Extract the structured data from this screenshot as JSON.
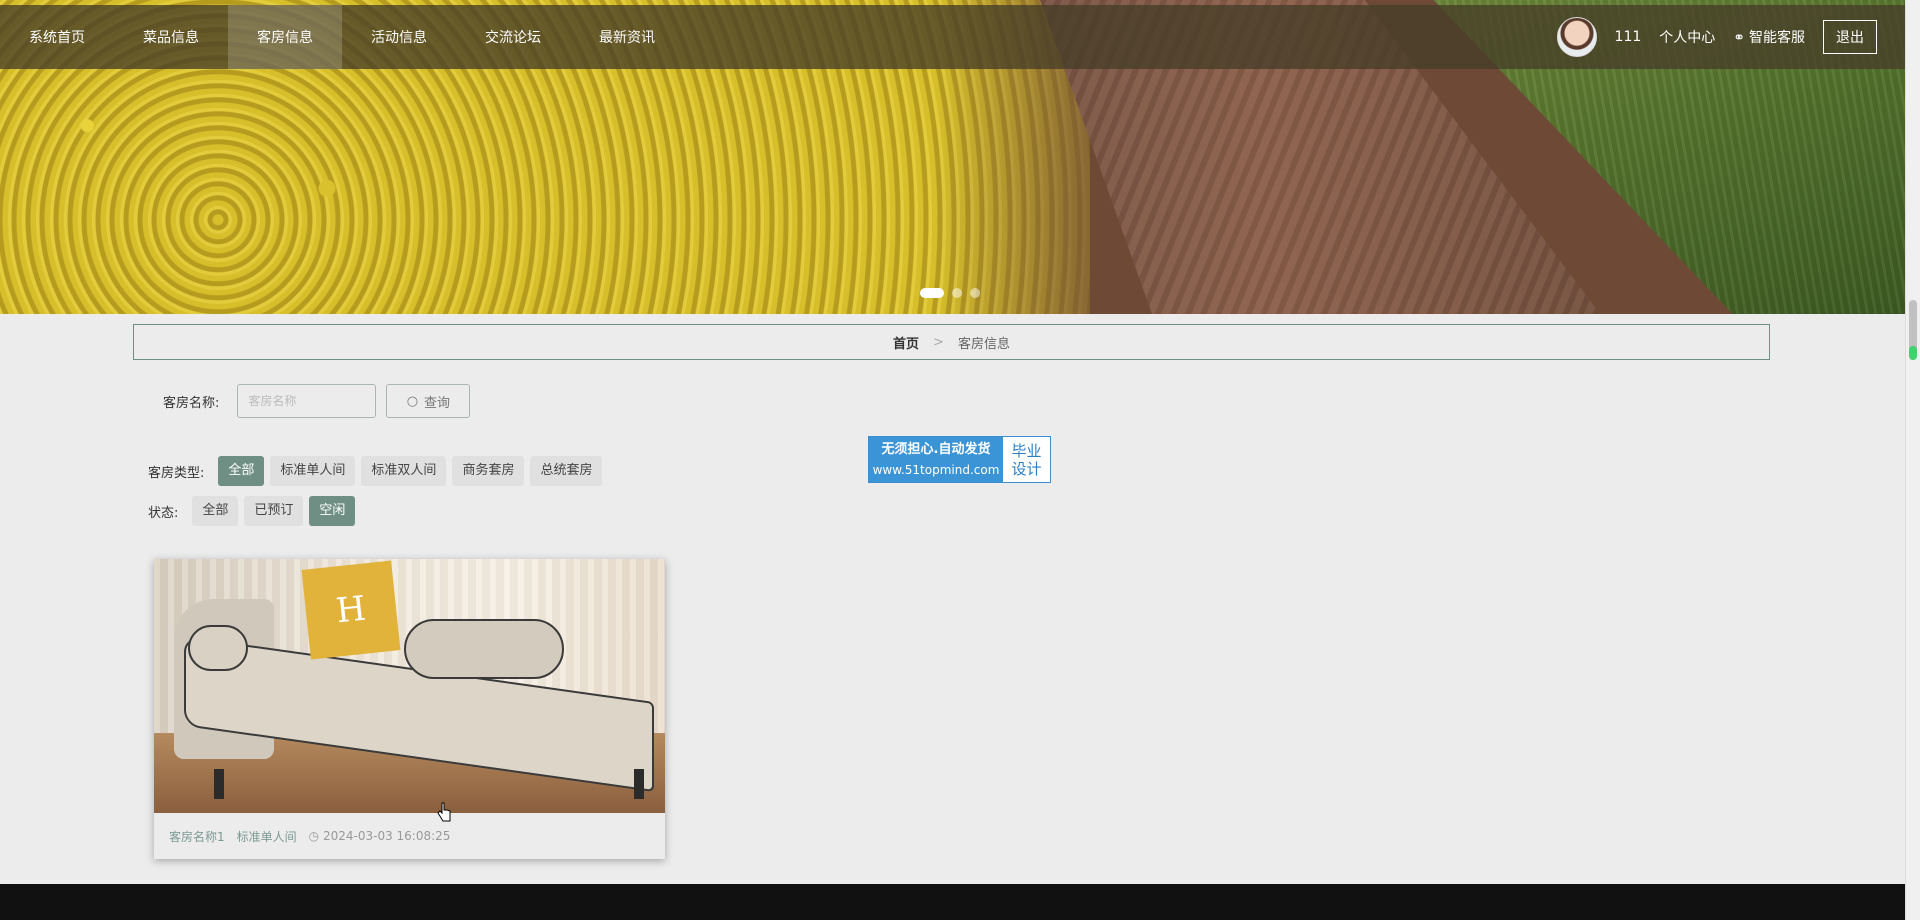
{
  "nav": {
    "items": [
      "系统首页",
      "菜品信息",
      "客房信息",
      "活动信息",
      "交流论坛",
      "最新资讯"
    ],
    "active_index": 2,
    "username": "111",
    "personal_center": "个人中心",
    "service": "智能客服",
    "logout": "退出"
  },
  "breadcrumb": {
    "home": "首页",
    "sep": ">",
    "current": "客房信息"
  },
  "search": {
    "label": "客房名称:",
    "placeholder": "客房名称",
    "button": "查询"
  },
  "filters": {
    "type_label": "客房类型:",
    "types": [
      "全部",
      "标准单人间",
      "标准双人间",
      "商务套房",
      "总统套房"
    ],
    "type_active": 0,
    "status_label": "状态:",
    "statuses": [
      "全部",
      "已预订",
      "空闲"
    ],
    "status_active": 2
  },
  "ad": {
    "line1": "无须担心.自动发货",
    "line2": "www.51topmind.com",
    "right1": "毕业",
    "right2": "设计"
  },
  "card": {
    "name": "客房名称1",
    "type": "标准单人间",
    "time": "2024-03-03 16:08:25",
    "pillow_letter": "H"
  },
  "colors": {
    "accent": "#6f8f85",
    "nav_bg": "#463e28",
    "footer": "#111111"
  }
}
